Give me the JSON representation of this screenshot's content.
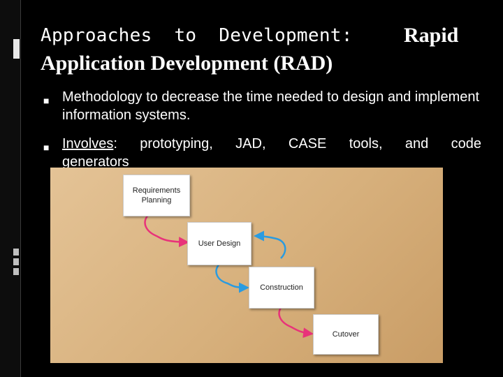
{
  "title": {
    "line1": "Approaches  to  Development:",
    "rapid": "Rapid",
    "line2": "Application Development (RAD)"
  },
  "bullets": [
    {
      "text": "Methodology to decrease the time needed to design and implement information systems."
    },
    {
      "label": "Involves",
      "colon": ":",
      "words": [
        "prototyping,",
        "JAD,",
        "CASE",
        "tools,",
        "and",
        "code"
      ],
      "last_line": "generators"
    }
  ],
  "diagram": {
    "steps": [
      {
        "line1": "Requirements",
        "line2": "Planning"
      },
      {
        "line1": "User Design"
      },
      {
        "line1": "Construction"
      },
      {
        "line1": "Cutover"
      }
    ],
    "colors": {
      "forward_arrow": "#e8337a",
      "back_arrow": "#2a9be0",
      "background": "#d7b07c"
    }
  },
  "icons": {
    "bullet": "square-bullet-icon"
  }
}
